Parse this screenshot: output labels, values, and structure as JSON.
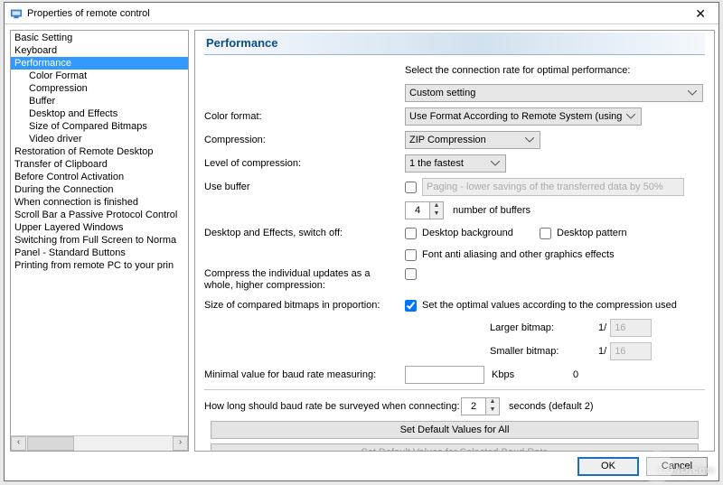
{
  "title": "Properties of remote control",
  "nav": {
    "items": [
      {
        "label": "Basic Setting",
        "level": 1
      },
      {
        "label": "Keyboard",
        "level": 1
      },
      {
        "label": "Performance",
        "level": 1,
        "selected": true
      },
      {
        "label": "Color Format",
        "level": 2
      },
      {
        "label": "Compression",
        "level": 2
      },
      {
        "label": "Buffer",
        "level": 2
      },
      {
        "label": "Desktop and Effects",
        "level": 2
      },
      {
        "label": "Size of Compared Bitmaps",
        "level": 2
      },
      {
        "label": "Video driver",
        "level": 2
      },
      {
        "label": "Restoration of Remote Desktop",
        "level": 1
      },
      {
        "label": "Transfer of Clipboard",
        "level": 1
      },
      {
        "label": "Before Control Activation",
        "level": 1
      },
      {
        "label": "During the Connection",
        "level": 1
      },
      {
        "label": "When connection is finished",
        "level": 1
      },
      {
        "label": "Scroll Bar a Passive Protocol Control",
        "level": 1
      },
      {
        "label": "Upper Layered Windows",
        "level": 1
      },
      {
        "label": "Switching from Full Screen to Norma",
        "level": 1
      },
      {
        "label": "Panel - Standard Buttons",
        "level": 1
      },
      {
        "label": "Printing from remote PC to your prin",
        "level": 1
      }
    ]
  },
  "panel": {
    "heading": "Performance",
    "intro": "Select the connection rate for optimal performance:",
    "rate_value": "Custom setting",
    "color_format_label": "Color format:",
    "color_format_value": "Use Format According to Remote System (using",
    "compression_label": "Compression:",
    "compression_value": "ZIP Compression",
    "level_label": "Level of compression:",
    "level_value": "1 the fastest",
    "buffer_label": "Use buffer",
    "buffer_paging": "Paging - lower savings of the transferred data by 50%",
    "buffer_count": "4",
    "buffer_count_label": "number of buffers",
    "desktop_label": "Desktop and Effects, switch off:",
    "cb_desktop_bg": "Desktop background",
    "cb_desktop_pattern": "Desktop pattern",
    "cb_font_aa": "Font anti aliasing and other graphics effects",
    "compress_whole_label": "Compress the individual updates as a whole, higher compression:",
    "size_bitmaps_label": "Size of compared bitmaps in proportion:",
    "cb_optimal": "Set the optimal values according to the compression used",
    "larger_bitmap_label": "Larger bitmap:",
    "smaller_bitmap_label": "Smaller bitmap:",
    "one_over": "1/",
    "bitmap_value": "16",
    "min_baud_label": "Minimal value for baud rate measuring:",
    "kbps": "Kbps",
    "zero": "0",
    "survey_label": "How long should baud rate be surveyed when connecting:",
    "survey_value": "2",
    "survey_suffix": "seconds (default 2)",
    "btn_all": "Set Default Values for All",
    "btn_sel": "Set Default Values for Selected Baud Rate"
  },
  "footer": {
    "ok": "OK",
    "cancel": "Cancel"
  },
  "watermark": "LO4D.com"
}
